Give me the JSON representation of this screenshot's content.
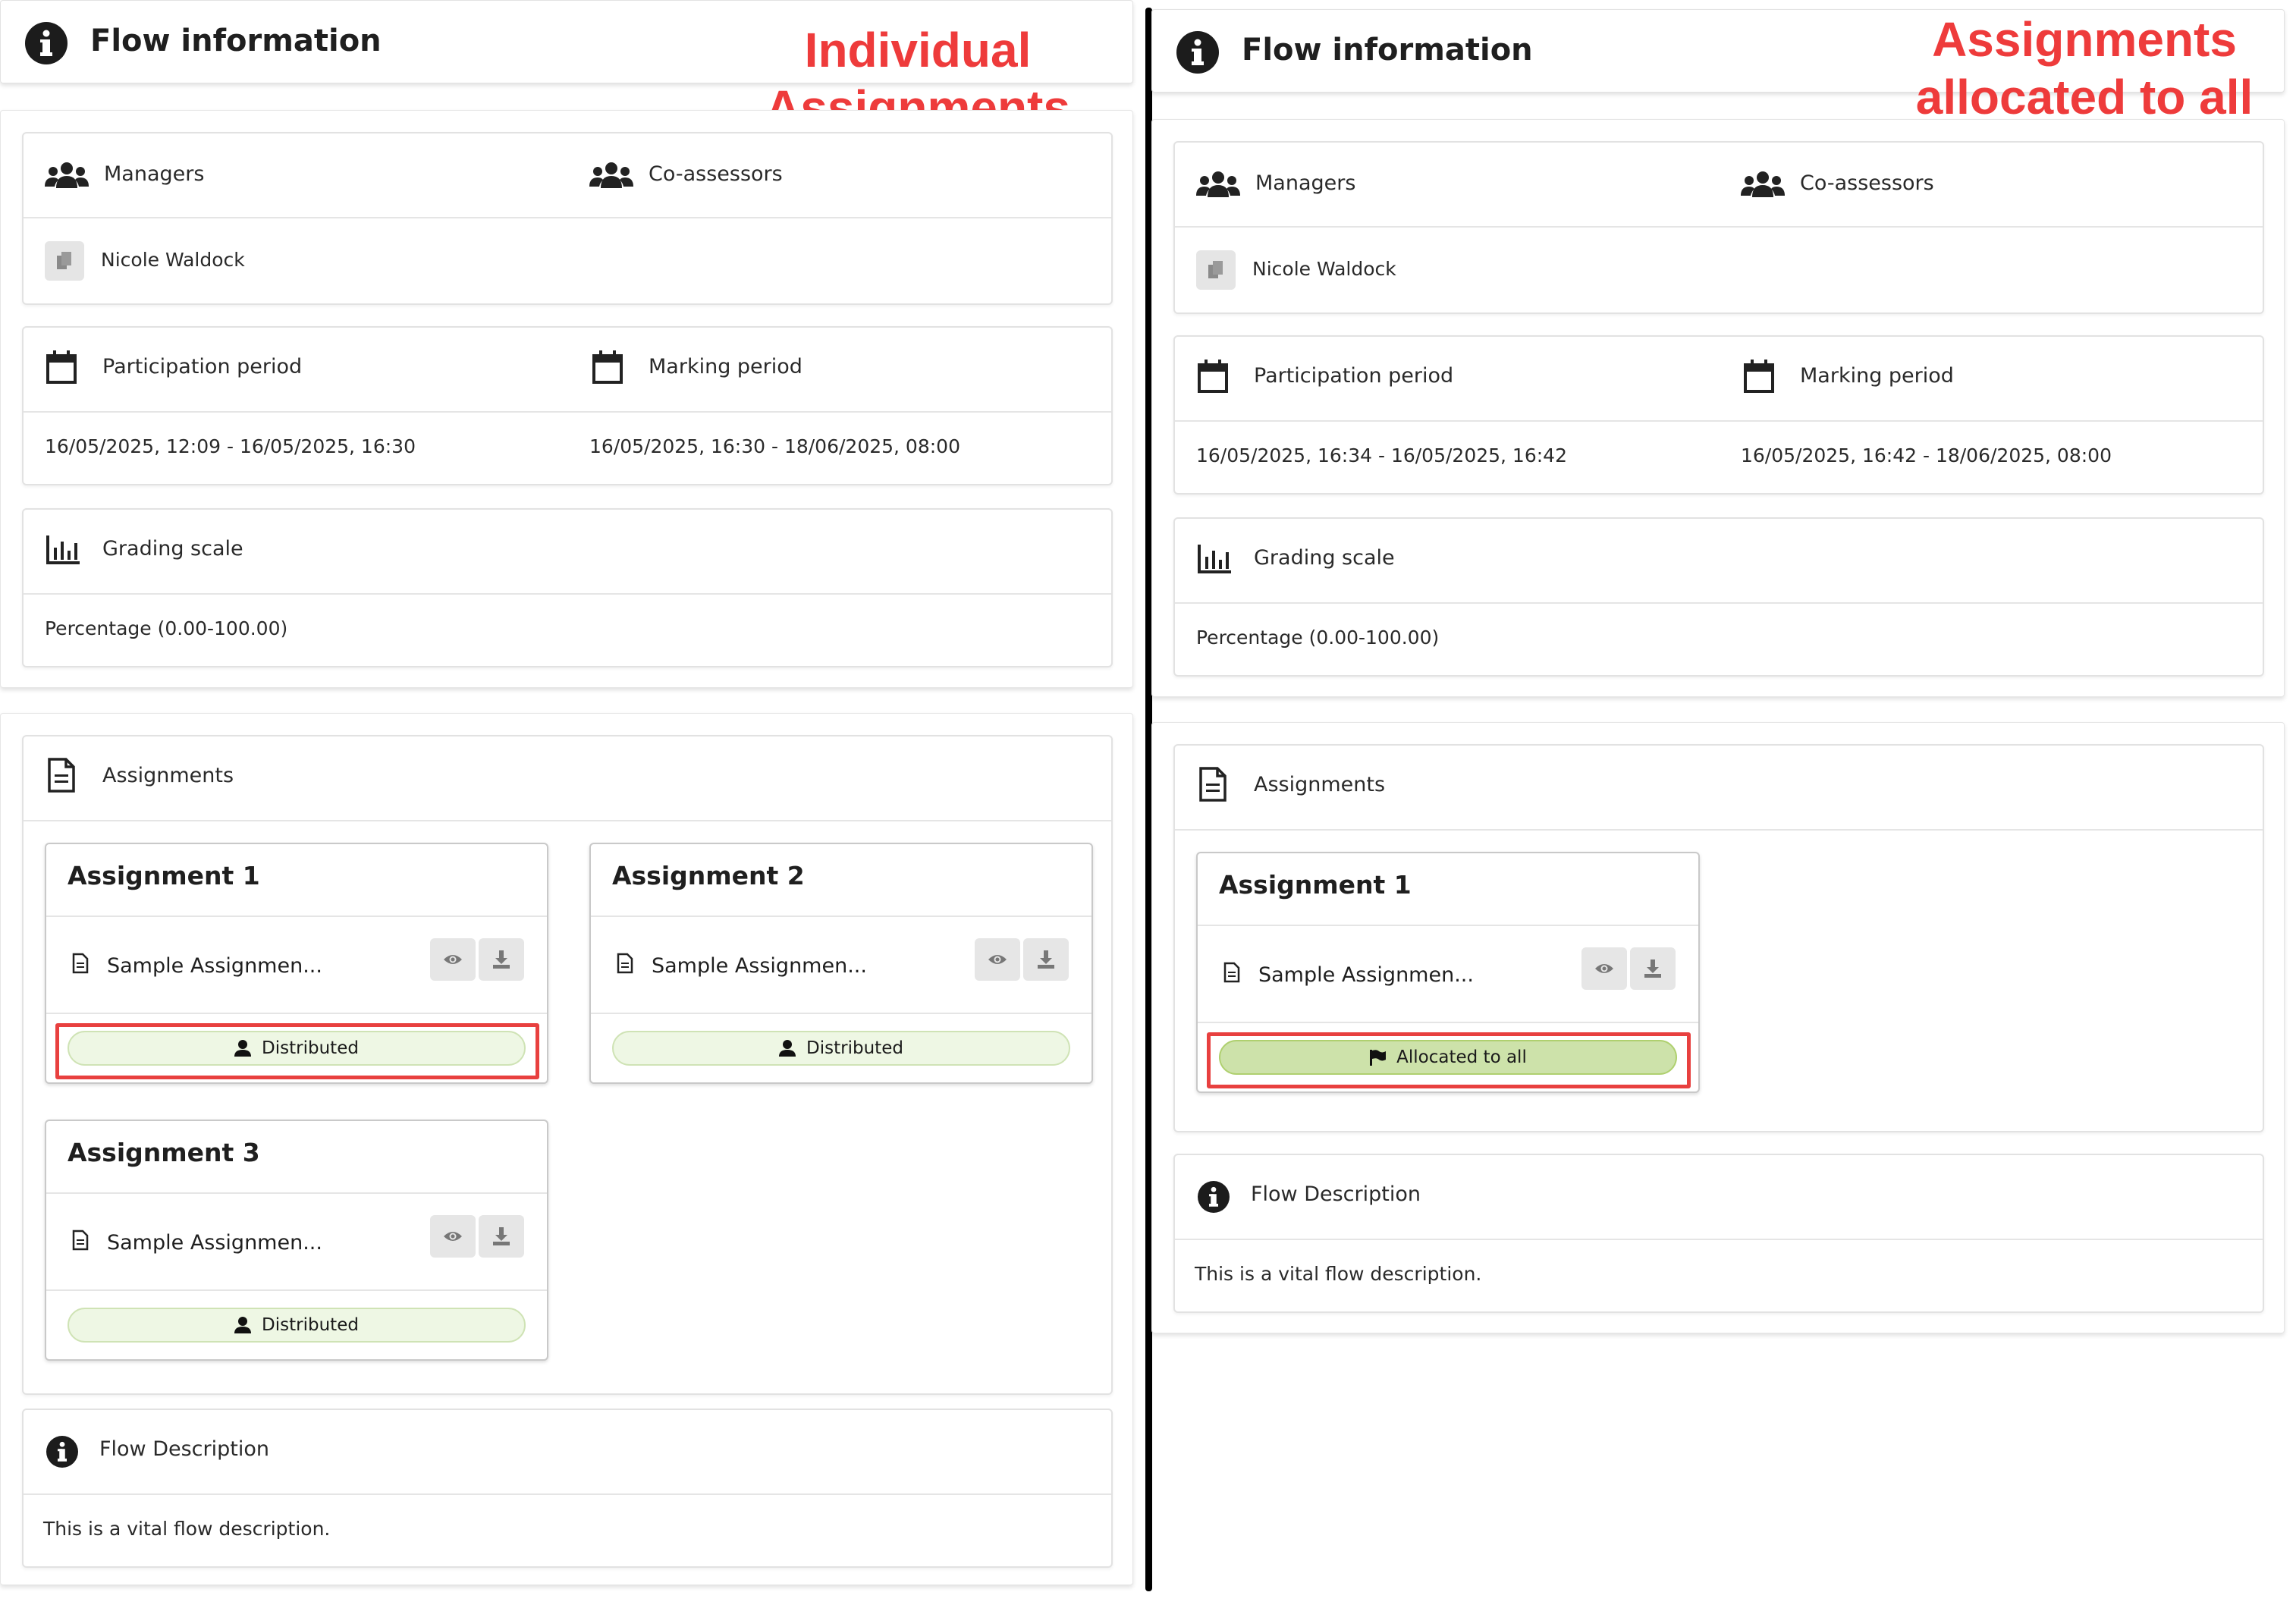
{
  "annotations": {
    "left": [
      "Individual",
      "Assignments"
    ],
    "right": [
      "Assignments",
      "allocated to all"
    ]
  },
  "panels": {
    "left": {
      "header_title": "Flow information",
      "managers_label": "Managers",
      "coassessors_label": "Co-assessors",
      "manager_name": "Nicole Waldock",
      "participation_label": "Participation period",
      "marking_label": "Marking period",
      "participation_value": "16/05/2025, 12:09 - 16/05/2025, 16:30",
      "marking_value": "16/05/2025, 16:30 - 18/06/2025, 08:00",
      "grading_label": "Grading scale",
      "grading_value": "Percentage (0.00-100.00)",
      "assignments_label": "Assignments",
      "assignments": [
        {
          "title": "Assignment 1",
          "file": "Sample Assignmen...",
          "status": "Distributed"
        },
        {
          "title": "Assignment 2",
          "file": "Sample Assignmen...",
          "status": "Distributed"
        },
        {
          "title": "Assignment 3",
          "file": "Sample Assignmen...",
          "status": "Distributed"
        }
      ],
      "description_label": "Flow Description",
      "description_value": "This is a vital flow description."
    },
    "right": {
      "header_title": "Flow information",
      "managers_label": "Managers",
      "coassessors_label": "Co-assessors",
      "manager_name": "Nicole Waldock",
      "participation_label": "Participation period",
      "marking_label": "Marking period",
      "participation_value": "16/05/2025, 16:34 - 16/05/2025, 16:42",
      "marking_value": "16/05/2025, 16:42 - 18/06/2025, 08:00",
      "grading_label": "Grading scale",
      "grading_value": "Percentage (0.00-100.00)",
      "assignments_label": "Assignments",
      "assignments": [
        {
          "title": "Assignment 1",
          "file": "Sample Assignmen...",
          "status": "Allocated to all"
        }
      ],
      "description_label": "Flow Description",
      "description_value": "This is a vital flow description."
    }
  },
  "colors": {
    "annotation": "#ee3b3b",
    "highlight_box": "#e8403f",
    "pill_light": "#eef7e4",
    "pill_solid": "#cde2aa"
  },
  "icons": {
    "header": "info-circle-icon",
    "managers": "users-group-icon",
    "calendar": "calendar-icon",
    "grading": "bar-chart-icon",
    "assignments": "document-icon",
    "view": "eye-icon",
    "download": "download-icon",
    "distributed": "user-icon",
    "allocated": "flag-icon"
  }
}
